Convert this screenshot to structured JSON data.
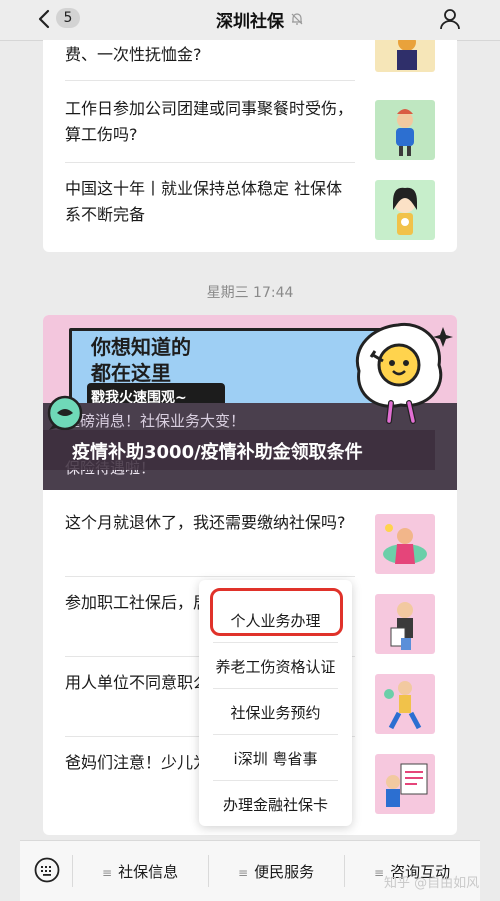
{
  "header": {
    "badge": "5",
    "title": "深圳社保"
  },
  "card1": {
    "items": [
      {
        "text": "费、一次性抚恤金?"
      },
      {
        "text": "工作日参加公司团建或同事聚餐时受伤，算工伤吗?"
      },
      {
        "text": "中国这十年丨就业保持总体稳定 社保体系不断完备"
      }
    ]
  },
  "timestamp": "星期三 17:44",
  "banner": {
    "line1": "你想知道的",
    "line2": "都在这里",
    "line3": "戳我火速围观~",
    "sub1": "重磅消息！社保业务大变！",
    "sub2": "保险待遇啦！"
  },
  "overlay_text": "疫情补助3000/疫情补助金领取条件",
  "card2": {
    "items": [
      {
        "text": "这个月就退休了，我还需要缴纳社保吗?"
      },
      {
        "text": "参加职工社保后，居民养老保险就没"
      },
      {
        "text": "用人单位不同意职么办?"
      },
      {
        "text": "爸妈们注意！少儿为孩子健康备好保"
      }
    ]
  },
  "popup": {
    "items": [
      "个人业务办理",
      "养老工伤资格认证",
      "社保业务预约",
      "i深圳 粤省事",
      "办理金融社保卡"
    ]
  },
  "bottombar": {
    "tabs": [
      "社保信息",
      "便民服务",
      "咨询互动"
    ]
  },
  "watermark": "知乎 @自由如风",
  "colors": {
    "highlight": "#e0322a",
    "banner_pink": "#f3c6dd",
    "banner_blue": "#9ecff4"
  }
}
